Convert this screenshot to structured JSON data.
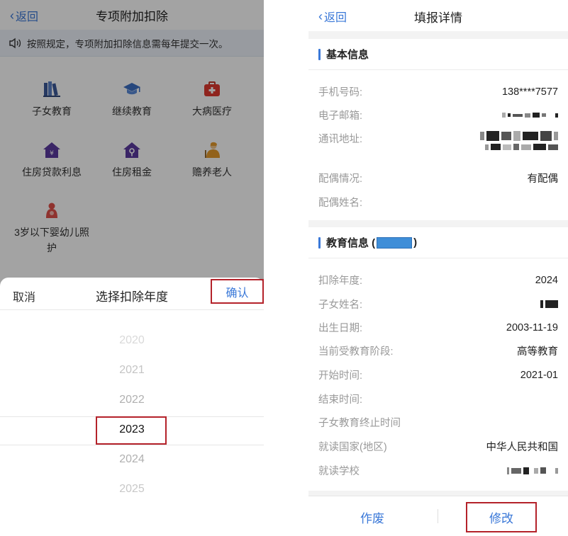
{
  "left": {
    "nav": {
      "back": "返回",
      "title": "专项附加扣除"
    },
    "notice": "按照规定，专项附加扣除信息需每年提交一次。",
    "categories": [
      {
        "icon": "books-icon",
        "label": "子女教育"
      },
      {
        "icon": "graduation-cap-icon",
        "label": "继续教育"
      },
      {
        "icon": "medical-kit-icon",
        "label": "大病医疗"
      },
      {
        "icon": "house-yen-icon",
        "label": "住房贷款利息"
      },
      {
        "icon": "house-key-icon",
        "label": "住房租金"
      },
      {
        "icon": "elderly-person-icon",
        "label": "赡养老人"
      },
      {
        "icon": "mother-baby-icon",
        "label": "3岁以下婴幼儿照护"
      }
    ],
    "sheet": {
      "cancel": "取消",
      "title": "选择扣除年度",
      "confirm": "确认",
      "years": [
        "2020",
        "2021",
        "2022",
        "2023",
        "2024",
        "2025"
      ],
      "selected": "2023"
    }
  },
  "right": {
    "nav": {
      "back": "返回",
      "title": "填报详情"
    },
    "basic": {
      "title": "基本信息",
      "phone_label": "手机号码:",
      "phone_value": "138****7577",
      "email_label": "电子邮箱:",
      "address_label": "通讯地址:",
      "spouse_status_label": "配偶情况:",
      "spouse_status_value": "有配偶",
      "spouse_name_label": "配偶姓名:"
    },
    "education": {
      "title_prefix": "教育信息 (",
      "title_suffix": ")",
      "year_label": "扣除年度:",
      "year_value": "2024",
      "child_name_label": "子女姓名:",
      "birth_label": "出生日期:",
      "birth_value": "2003-11-19",
      "stage_label": "当前受教育阶段:",
      "stage_value": "高等教育",
      "start_label": "开始时间:",
      "start_value": "2021-01",
      "end_label": "结束时间:",
      "terminate_label": "子女教育终止时间",
      "country_label": "就读国家(地区)",
      "country_value": "中华人民共和国",
      "school_label": "就读学校"
    },
    "footer": {
      "void": "作废",
      "edit": "修改"
    }
  },
  "colors": {
    "accent_blue": "#3a78d8",
    "highlight_red": "#b4222a",
    "section_bar": "#3a78d8"
  }
}
